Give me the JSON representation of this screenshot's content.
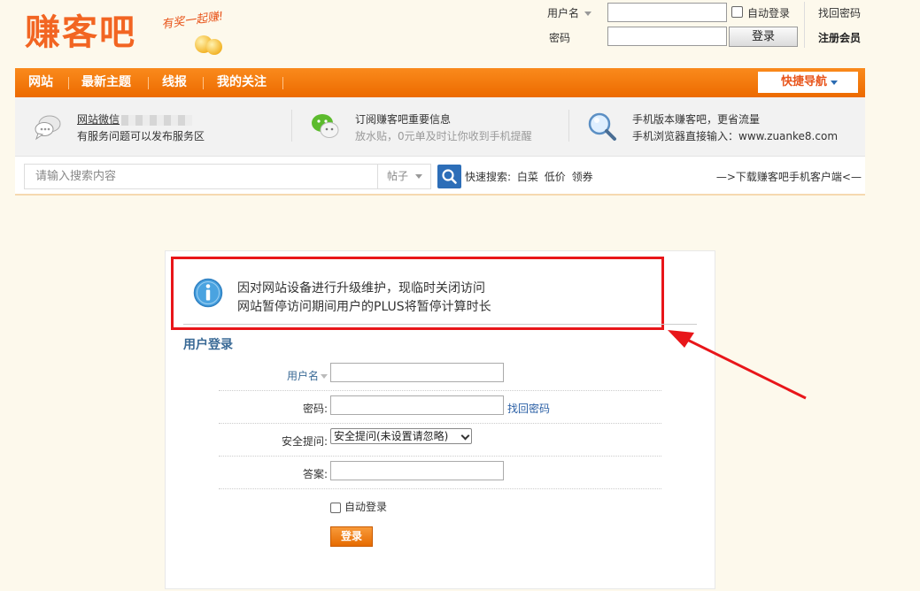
{
  "header": {
    "logo_text": "赚客吧",
    "logo_slogan": "有奖一起赚!",
    "top_login": {
      "username_label": "用户名",
      "password_label": "密码",
      "auto_login": "自动登录",
      "login_button": "登录",
      "find_password": "找回密码",
      "register": "注册会员"
    }
  },
  "nav": {
    "items": [
      {
        "label": "网站"
      },
      {
        "label": "最新主题"
      },
      {
        "label": "线报"
      },
      {
        "label": "我的关注"
      }
    ],
    "quick_nav": "快捷导航"
  },
  "infobar": {
    "items": [
      {
        "line1": "网站微信",
        "line2": "有服务问题可以发布服务区",
        "icon": "chat-bubble-icon"
      },
      {
        "line1": "订阅赚客吧重要信息",
        "line2": "放水贴，0元单及时让你收到手机提醒",
        "icon": "wechat-icon"
      },
      {
        "line1": "手机版本赚客吧，更省流量",
        "line2": "手机浏览器直接输入：www.zuanke8.com",
        "icon": "magnifier-icon"
      }
    ]
  },
  "search": {
    "placeholder": "请输入搜索内容",
    "type": "帖子",
    "quick_label": "快速搜索:",
    "quick_items": [
      "白菜",
      "低价",
      "领券"
    ],
    "download_link": "—>下载赚客吧手机客户端<—"
  },
  "notice": {
    "line1": "因对网站设备进行升级维护，现临时关闭访问",
    "line2": "网站暂停访问期间用户的PLUS将暂停计算时长"
  },
  "login_form": {
    "title": "用户登录",
    "username_label": "用户名",
    "password_label": "密码:",
    "find_password": "找回密码",
    "question_label": "安全提问:",
    "question_value": "安全提问(未设置请忽略)",
    "answer_label": "答案:",
    "auto_login": "自动登录",
    "submit": "登录"
  },
  "colors": {
    "brand_orange": "#f26522",
    "nav_orange": "#f07a10",
    "link_blue": "#2a5fa5",
    "highlight_red": "#e8161a"
  }
}
